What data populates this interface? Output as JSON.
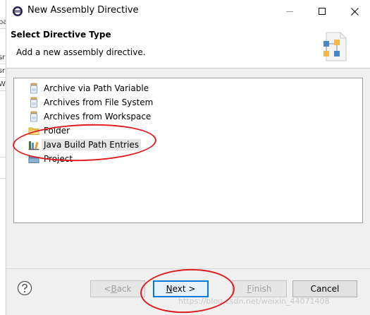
{
  "background_window": {
    "fragments": [
      "pa",
      "sr",
      "sr",
      "W"
    ]
  },
  "window": {
    "title": "New Assembly Directive",
    "controls": [
      "minimize",
      "maximize",
      "close"
    ]
  },
  "header": {
    "title": "Select Directive Type",
    "description": "Add a new assembly directive."
  },
  "directive_types": [
    {
      "label": "Archive via Path Variable",
      "icon": "jar-icon"
    },
    {
      "label": "Archives from File System",
      "icon": "jar-icon"
    },
    {
      "label": "Archives from Workspace",
      "icon": "jar-icon"
    },
    {
      "label": "Folder",
      "icon": "folder-icon"
    },
    {
      "label": "Java Build Path Entries",
      "icon": "library-icon",
      "selected": true
    },
    {
      "label": "Project",
      "icon": "project-icon"
    }
  ],
  "buttons": {
    "back": {
      "prefix": "< ",
      "mnemonic": "B",
      "rest": "ack"
    },
    "next": {
      "mnemonic": "N",
      "rest": "ext >"
    },
    "finish": {
      "mnemonic": "F",
      "rest": "inish"
    },
    "cancel": "Cancel"
  },
  "annotation_color": "#e0191c",
  "watermark": "https://blog.csdn.net/weixin_44071408"
}
